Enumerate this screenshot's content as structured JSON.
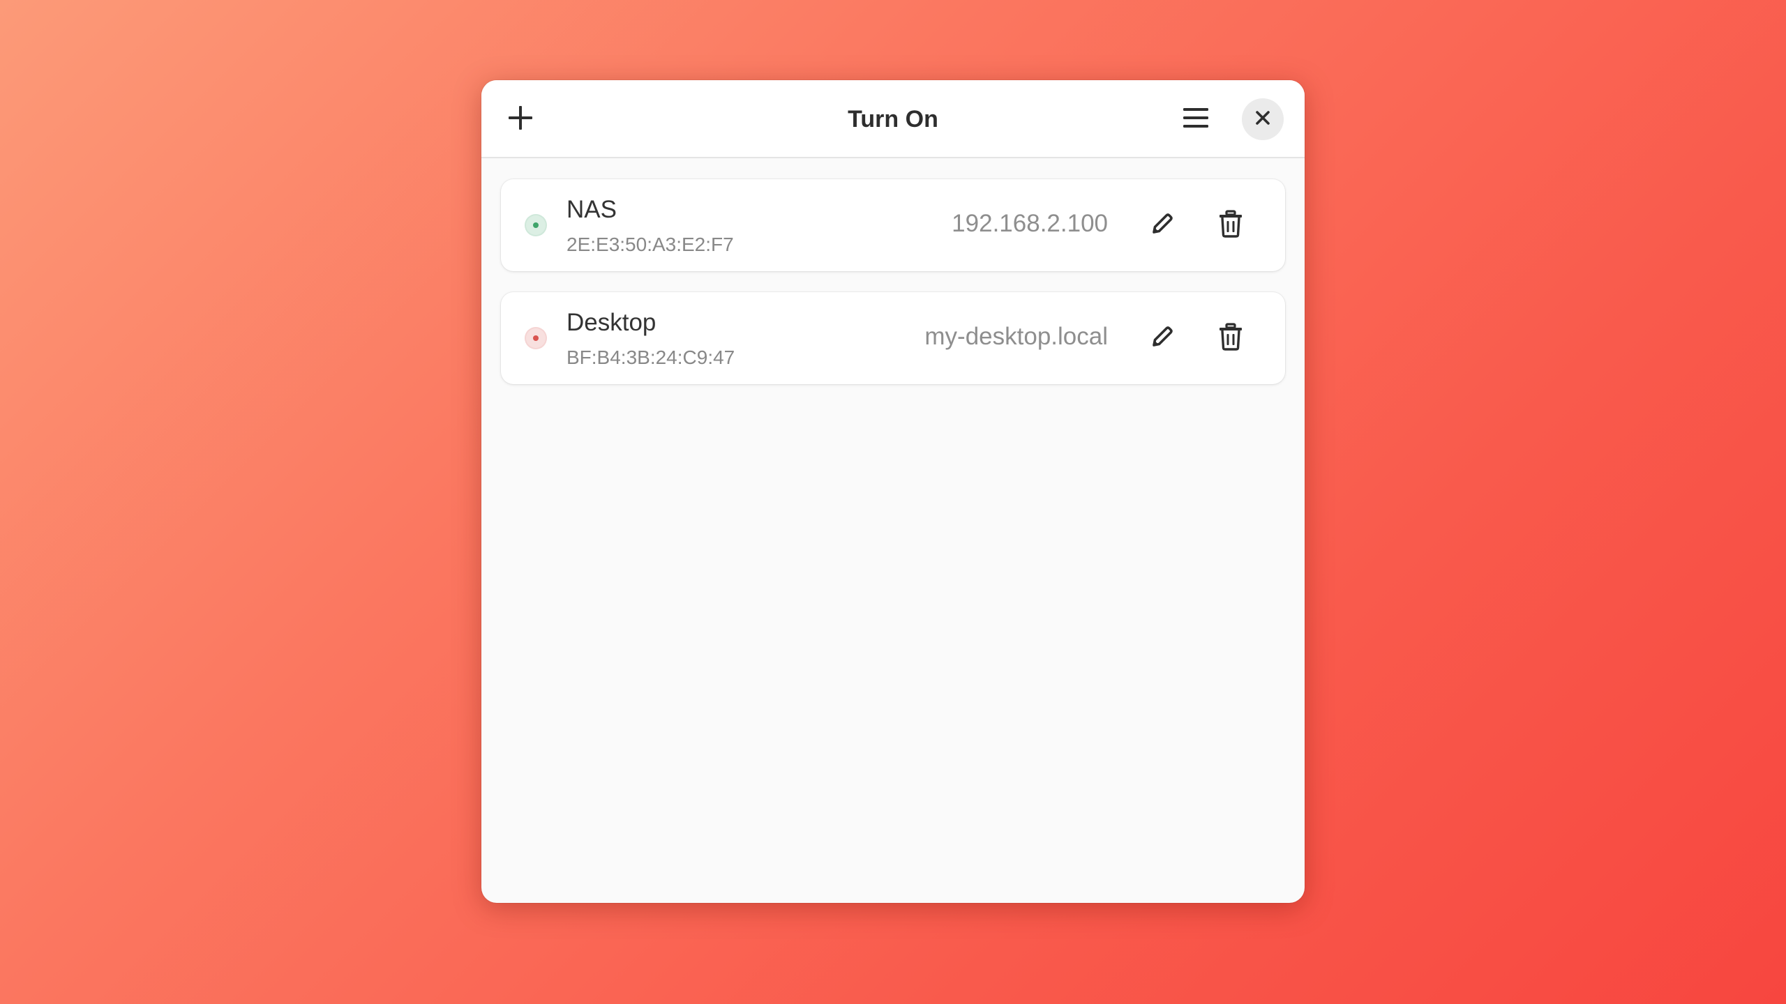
{
  "window": {
    "title": "Turn On"
  },
  "headerbar": {
    "add_icon": "plus-icon",
    "menu_icon": "hamburger-menu-icon",
    "close_icon": "close-icon"
  },
  "devices": [
    {
      "name": "NAS",
      "mac": "2E:E3:50:A3:E2:F7",
      "address": "192.168.2.100",
      "status": "online",
      "status_color": "#3fa46a",
      "edit_icon": "pencil-icon",
      "delete_icon": "trash-icon"
    },
    {
      "name": "Desktop",
      "mac": "BF:B4:3B:24:C9:47",
      "address": "my-desktop.local",
      "status": "offline",
      "status_color": "#d9534f",
      "edit_icon": "pencil-icon",
      "delete_icon": "trash-icon"
    }
  ],
  "colors": {
    "background_start": "#fc9a78",
    "background_end": "#f7463f",
    "window_bg": "#fafafa",
    "card_bg": "#ffffff"
  }
}
